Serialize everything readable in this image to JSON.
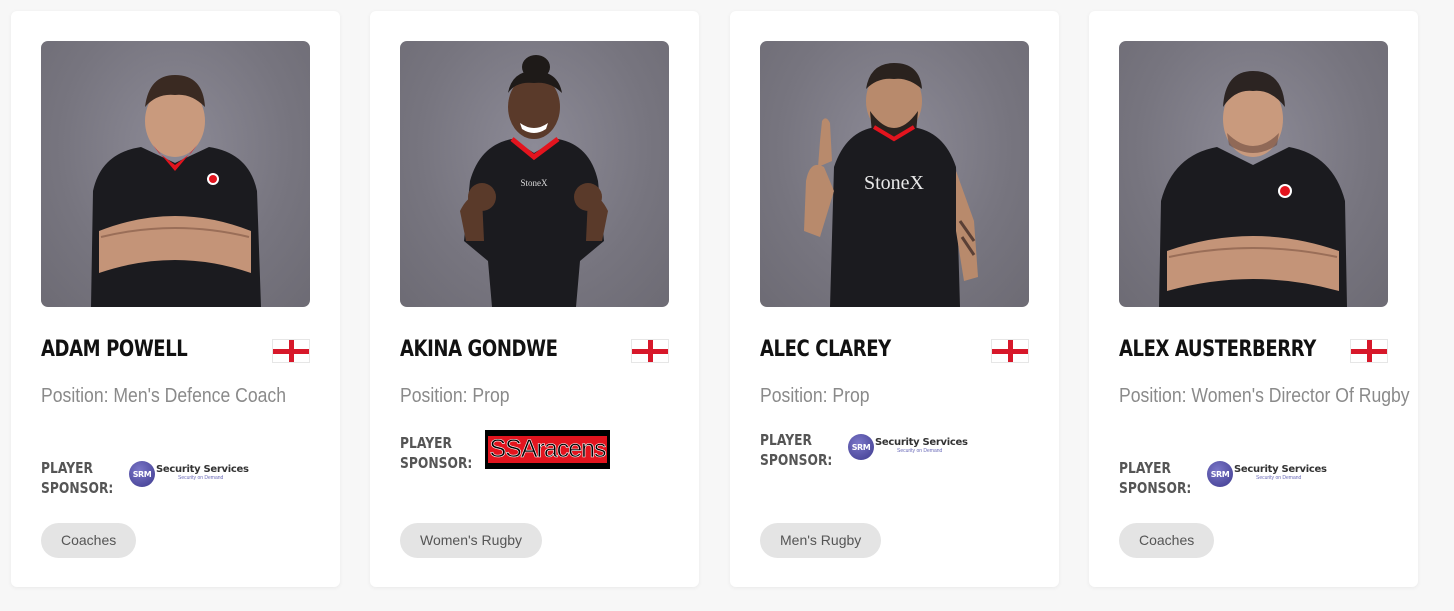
{
  "players": [
    {
      "name": "Adam Powell",
      "flag": "england-flag",
      "position": "Position: Men's Defence Coach",
      "sponsor_label_1": "Player",
      "sponsor_label_2": "Sponsor:",
      "sponsor": {
        "logo": "srm-security-logo",
        "line1": "Security Services",
        "line2": "Security on Demand",
        "mark": "SRM"
      },
      "tag": "Coaches"
    },
    {
      "name": "Akina Gondwe",
      "flag": "england-flag",
      "position": "Position: Prop",
      "sponsor_label_1": "Player",
      "sponsor_label_2": "Sponsor:",
      "sponsor": {
        "logo": "ssaracens-logo",
        "text": "SSAracens"
      },
      "tag": "Women's Rugby"
    },
    {
      "name": "Alec Clarey",
      "flag": "england-flag",
      "position": "Position: Prop",
      "sponsor_label_1": "Player",
      "sponsor_label_2": "Sponsor:",
      "sponsor": {
        "logo": "srm-security-logo",
        "line1": "Security Services",
        "line2": "Security on Demand",
        "mark": "SRM"
      },
      "tag": "Men's Rugby"
    },
    {
      "name": "Alex Austerberry",
      "flag": "england-flag",
      "position": "Position: Women's Director Of Rugby",
      "sponsor_label_1": "Player",
      "sponsor_label_2": "Sponsor:",
      "sponsor": {
        "logo": "srm-security-logo",
        "line1": "Security Services",
        "line2": "Security on Demand",
        "mark": "SRM"
      },
      "tag": "Coaches"
    }
  ],
  "colors": {
    "page_bg": "#f7f7f7",
    "card_bg": "#ffffff",
    "flag_red": "#d7182a",
    "tag_bg": "#e4e4e4",
    "photo_bg": "#7c7a84",
    "kit_black": "#1a1a1e",
    "kit_red": "#e3141e"
  }
}
